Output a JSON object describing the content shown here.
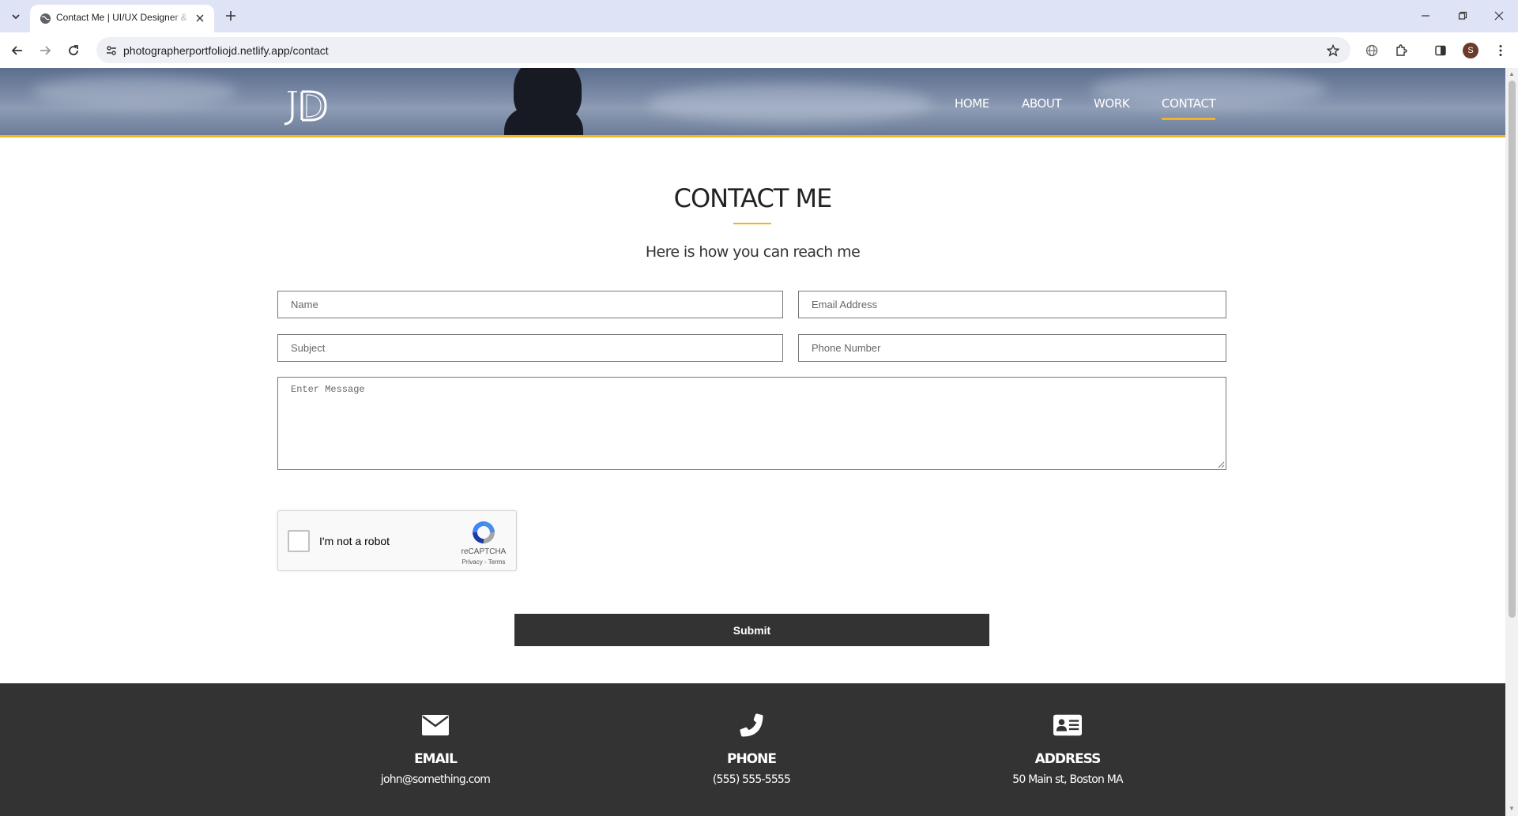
{
  "browser": {
    "tab_title": "Contact Me | UI/UX Designer & Photographer",
    "url": "photographerportfoliojd.netlify.app/contact",
    "profile_initial": "S"
  },
  "site": {
    "logo_text": "JD",
    "nav": [
      {
        "label": "HOME"
      },
      {
        "label": "ABOUT"
      },
      {
        "label": "WORK"
      },
      {
        "label": "CONTACT",
        "active": true
      }
    ],
    "accent_color": "#f0b323"
  },
  "contact": {
    "title": "CONTACT ME",
    "subtitle": "Here is how you can reach me",
    "form": {
      "name_placeholder": "Name",
      "email_placeholder": "Email Address",
      "subject_placeholder": "Subject",
      "phone_placeholder": "Phone Number",
      "message_placeholder": "Enter Message",
      "submit_label": "Submit"
    },
    "recaptcha": {
      "label": "I'm not a robot",
      "brand": "reCAPTCHA",
      "links": "Privacy - Terms"
    }
  },
  "footer": {
    "email": {
      "heading": "EMAIL",
      "value": "john@something.com",
      "icon": "envelope-icon"
    },
    "phone": {
      "heading": "PHONE",
      "value": "(555) 555-5555",
      "icon": "phone-icon"
    },
    "address": {
      "heading": "ADDRESS",
      "value": "50 Main st, Boston MA",
      "icon": "address-card-icon"
    }
  }
}
